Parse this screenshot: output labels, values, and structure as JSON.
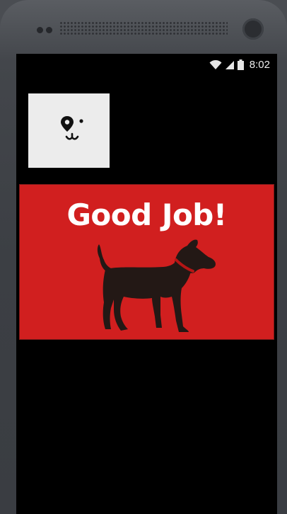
{
  "status_bar": {
    "time": "8:02",
    "icons": [
      "wifi-icon",
      "signal-icon",
      "battery-icon"
    ]
  },
  "app": {
    "logo_icon": "dog-face-pin-icon",
    "banner": {
      "title": "Good Job!",
      "image_icon": "dog-silhouette-icon",
      "background_color": "#d11f1f",
      "text_color": "#ffffff"
    }
  }
}
